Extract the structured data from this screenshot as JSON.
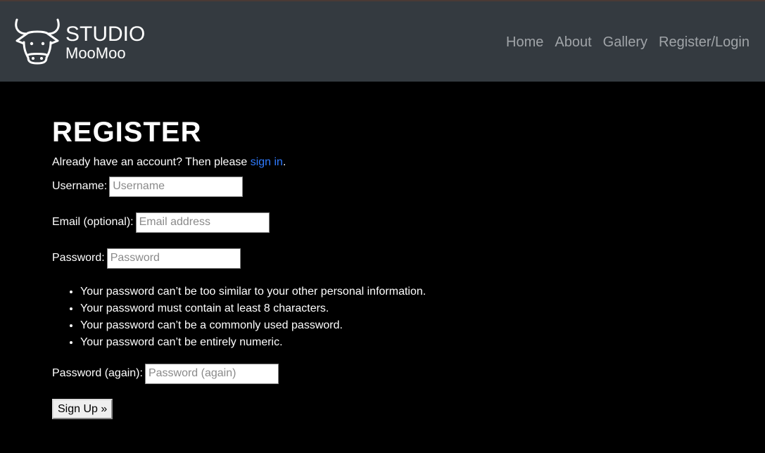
{
  "brand": {
    "line1": "STUDIO",
    "line2": "MooMoo",
    "logo_icon": "cow-head-icon"
  },
  "nav": {
    "items": [
      {
        "label": "Home"
      },
      {
        "label": "About"
      },
      {
        "label": "Gallery"
      },
      {
        "label": "Register/Login"
      }
    ]
  },
  "page": {
    "title": "REGISTER",
    "intro_prefix": "Already have an account? Then please ",
    "intro_link": "sign in",
    "intro_suffix": "."
  },
  "form": {
    "username": {
      "label": "Username:",
      "placeholder": "Username"
    },
    "email": {
      "label": "Email (optional):",
      "placeholder": "Email address"
    },
    "password": {
      "label": "Password:",
      "placeholder": "Password"
    },
    "help": [
      "Your password can’t be too similar to your other personal information.",
      "Your password must contain at least 8 characters.",
      "Your password can’t be a commonly used password.",
      "Your password can’t be entirely numeric."
    ],
    "password2": {
      "label": "Password (again):",
      "placeholder": "Password (again)"
    },
    "submit_label": "Sign Up »"
  },
  "colors": {
    "navbar_bg": "#343a40",
    "nav_link": "#a0a4a8",
    "link_accent": "#2f7bff",
    "page_bg": "#000000"
  }
}
